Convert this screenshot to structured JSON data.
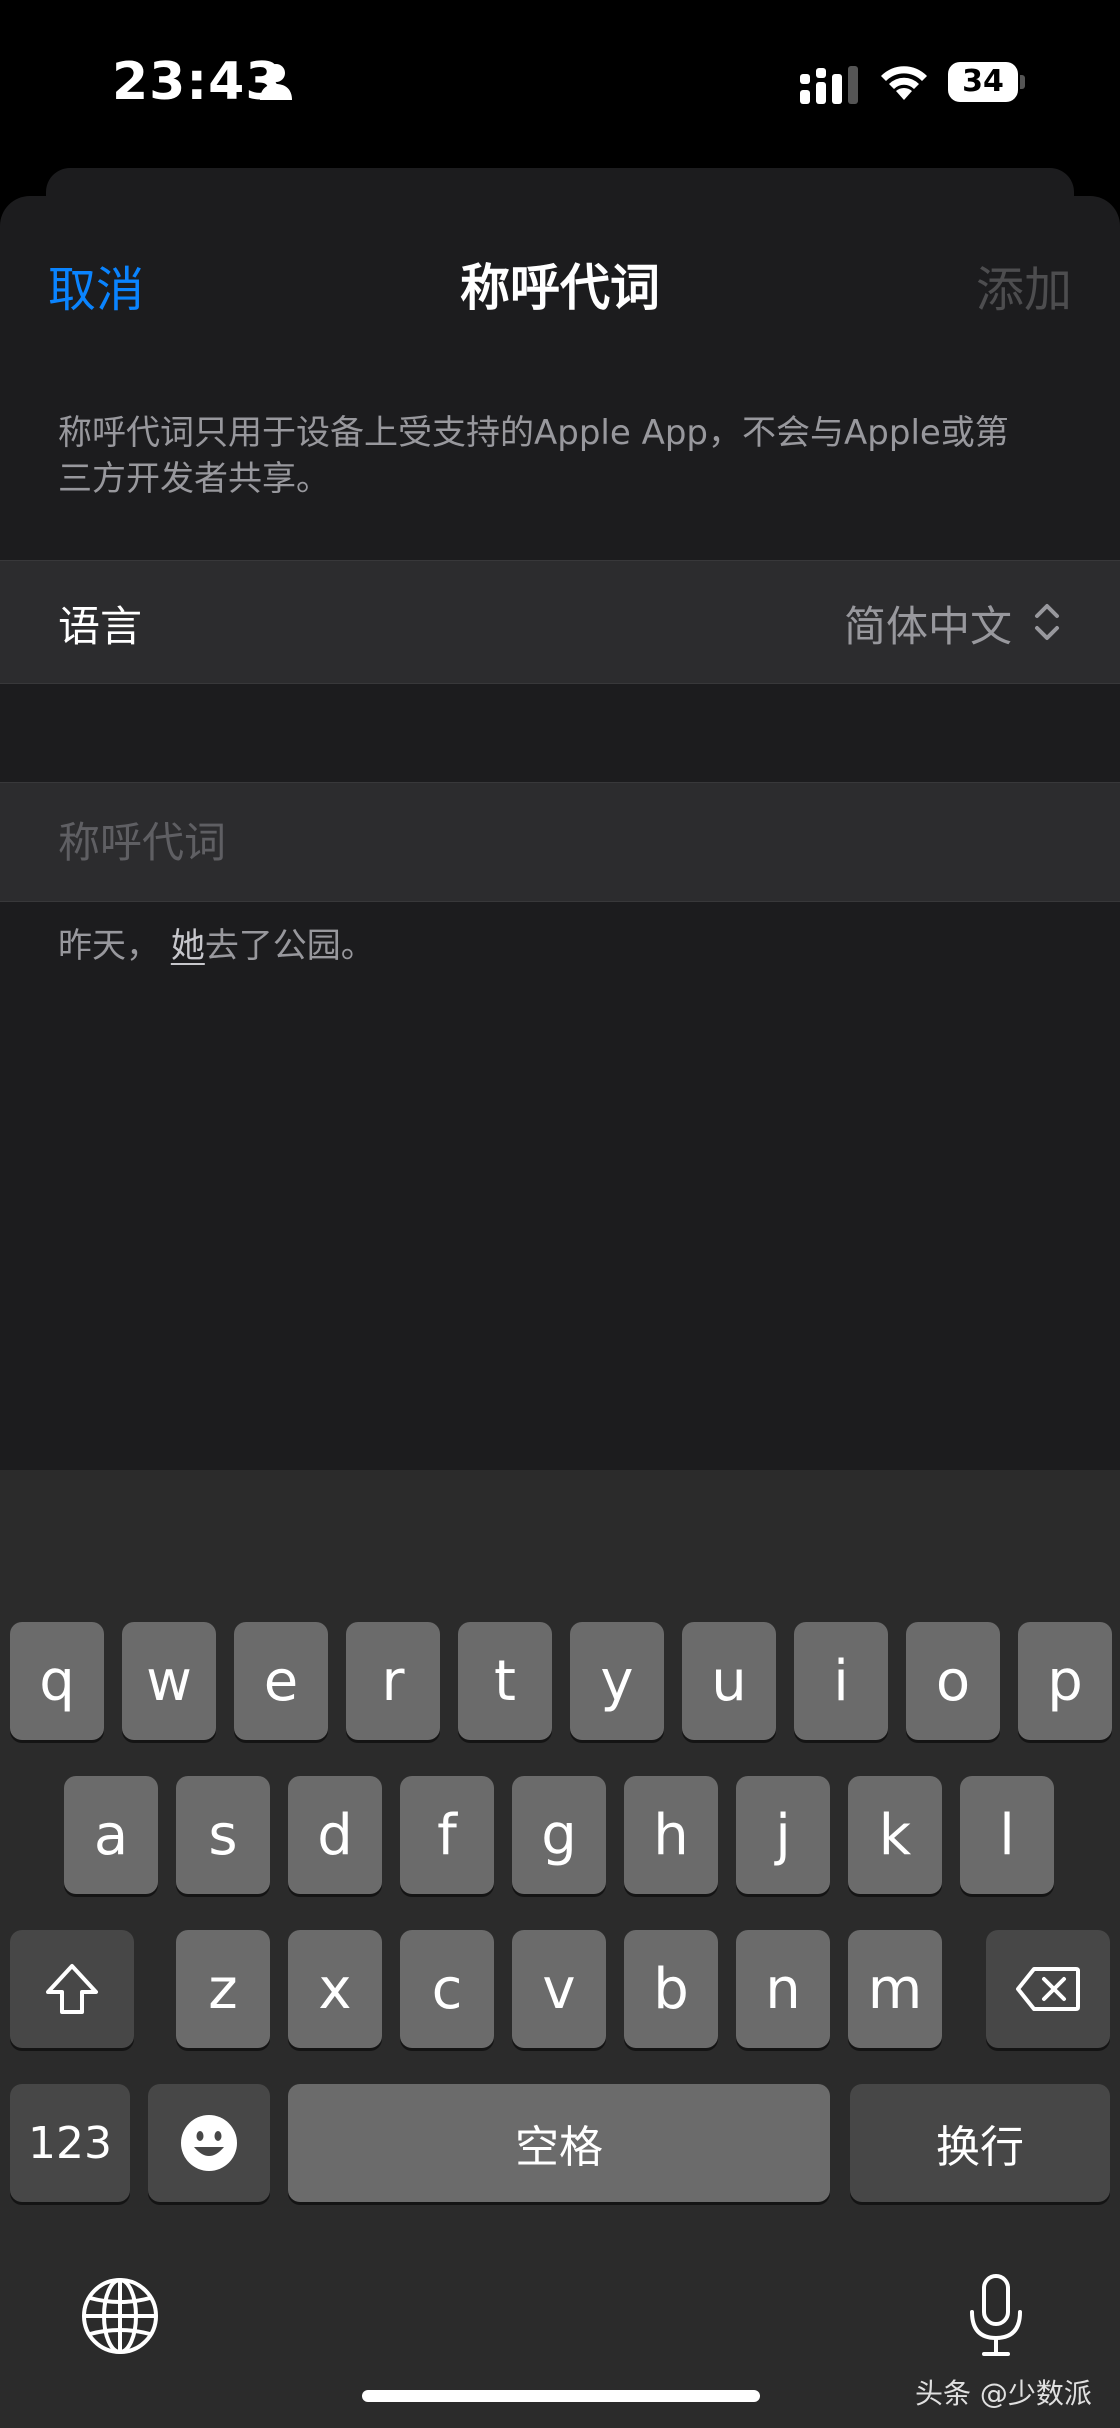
{
  "status_bar": {
    "time": "23:43",
    "battery_level": "34",
    "icons": [
      "person-icon",
      "signal-icon",
      "wifi-icon",
      "battery-icon"
    ]
  },
  "nav": {
    "cancel_label": "取消",
    "title": "称呼代词",
    "add_label": "添加"
  },
  "description": "称呼代词只用于设备上受支持的Apple App，不会与Apple或第三方开发者共享。",
  "language_row": {
    "label": "语言",
    "value": "简体中文"
  },
  "pronoun_input": {
    "placeholder": "称呼代词",
    "value": ""
  },
  "example": {
    "prefix": "昨天，",
    "pronoun": "她",
    "suffix": "去了公园。"
  },
  "keyboard": {
    "row1": [
      "q",
      "w",
      "e",
      "r",
      "t",
      "y",
      "u",
      "i",
      "o",
      "p"
    ],
    "row2": [
      "a",
      "s",
      "d",
      "f",
      "g",
      "h",
      "j",
      "k",
      "l"
    ],
    "row3": [
      "z",
      "x",
      "c",
      "v",
      "b",
      "n",
      "m"
    ],
    "numbers_label": "123",
    "space_label": "空格",
    "return_label": "换行"
  },
  "watermark": "头条 @少数派",
  "colors": {
    "accent": "#0a84ff",
    "background": "#1c1c1e",
    "cell": "#2c2c2e",
    "secondary_text": "#98989d",
    "disabled": "#4d4d4f"
  }
}
